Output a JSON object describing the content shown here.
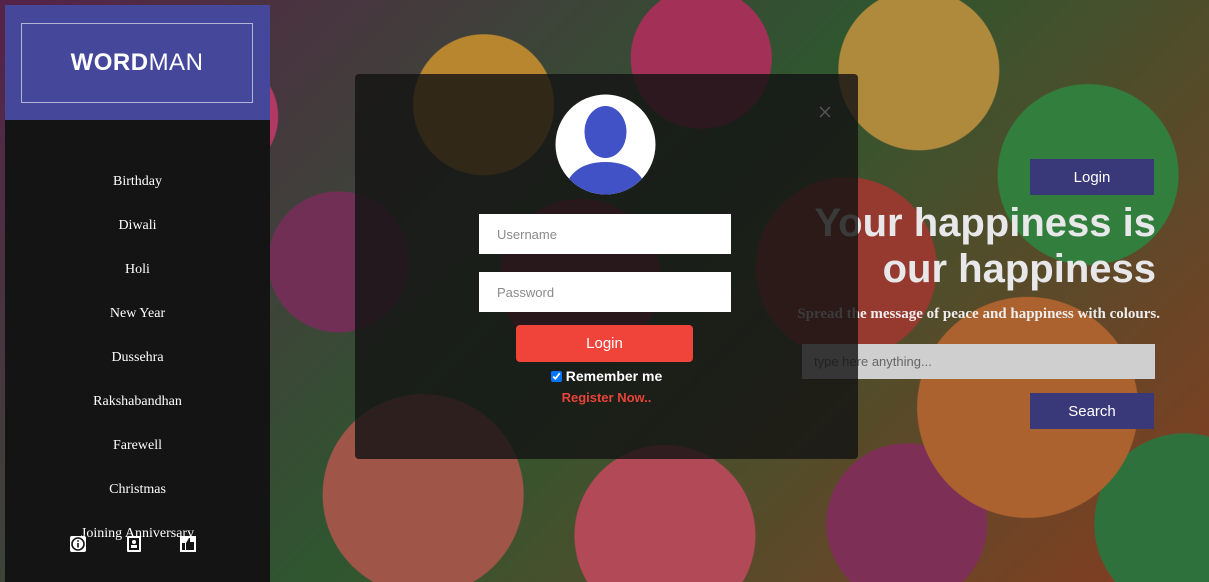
{
  "brand": {
    "strong": "WORD",
    "light": "MAN"
  },
  "sidebar": {
    "items": [
      {
        "label": "Birthday"
      },
      {
        "label": "Diwali"
      },
      {
        "label": "Holi"
      },
      {
        "label": "New Year"
      },
      {
        "label": "Dussehra"
      },
      {
        "label": "Rakshabandhan"
      },
      {
        "label": "Farewell"
      },
      {
        "label": "Christmas"
      },
      {
        "label": "Joining Anniversary"
      }
    ],
    "bottom_icons": [
      "info-icon",
      "contact-card-icon",
      "thumbs-up-icon"
    ]
  },
  "hero": {
    "login_label": "Login",
    "title_line1": "Your happiness is",
    "title_line2": "our happiness",
    "subtitle": "Spread the message of peace and happiness with colours.",
    "search_placeholder": "type here anything...",
    "search_label": "Search"
  },
  "modal": {
    "username_placeholder": "Username",
    "password_placeholder": "Password",
    "login_label": "Login",
    "remember_label": "Remember me",
    "register_label": "Register Now.."
  },
  "colors": {
    "sidebar_bg": "#141414",
    "brand_bg": "#45479b",
    "accent_button": "#39397a",
    "login_button": "#f0433a",
    "register_link": "#e8443a",
    "avatar_blue": "#4151c6"
  }
}
